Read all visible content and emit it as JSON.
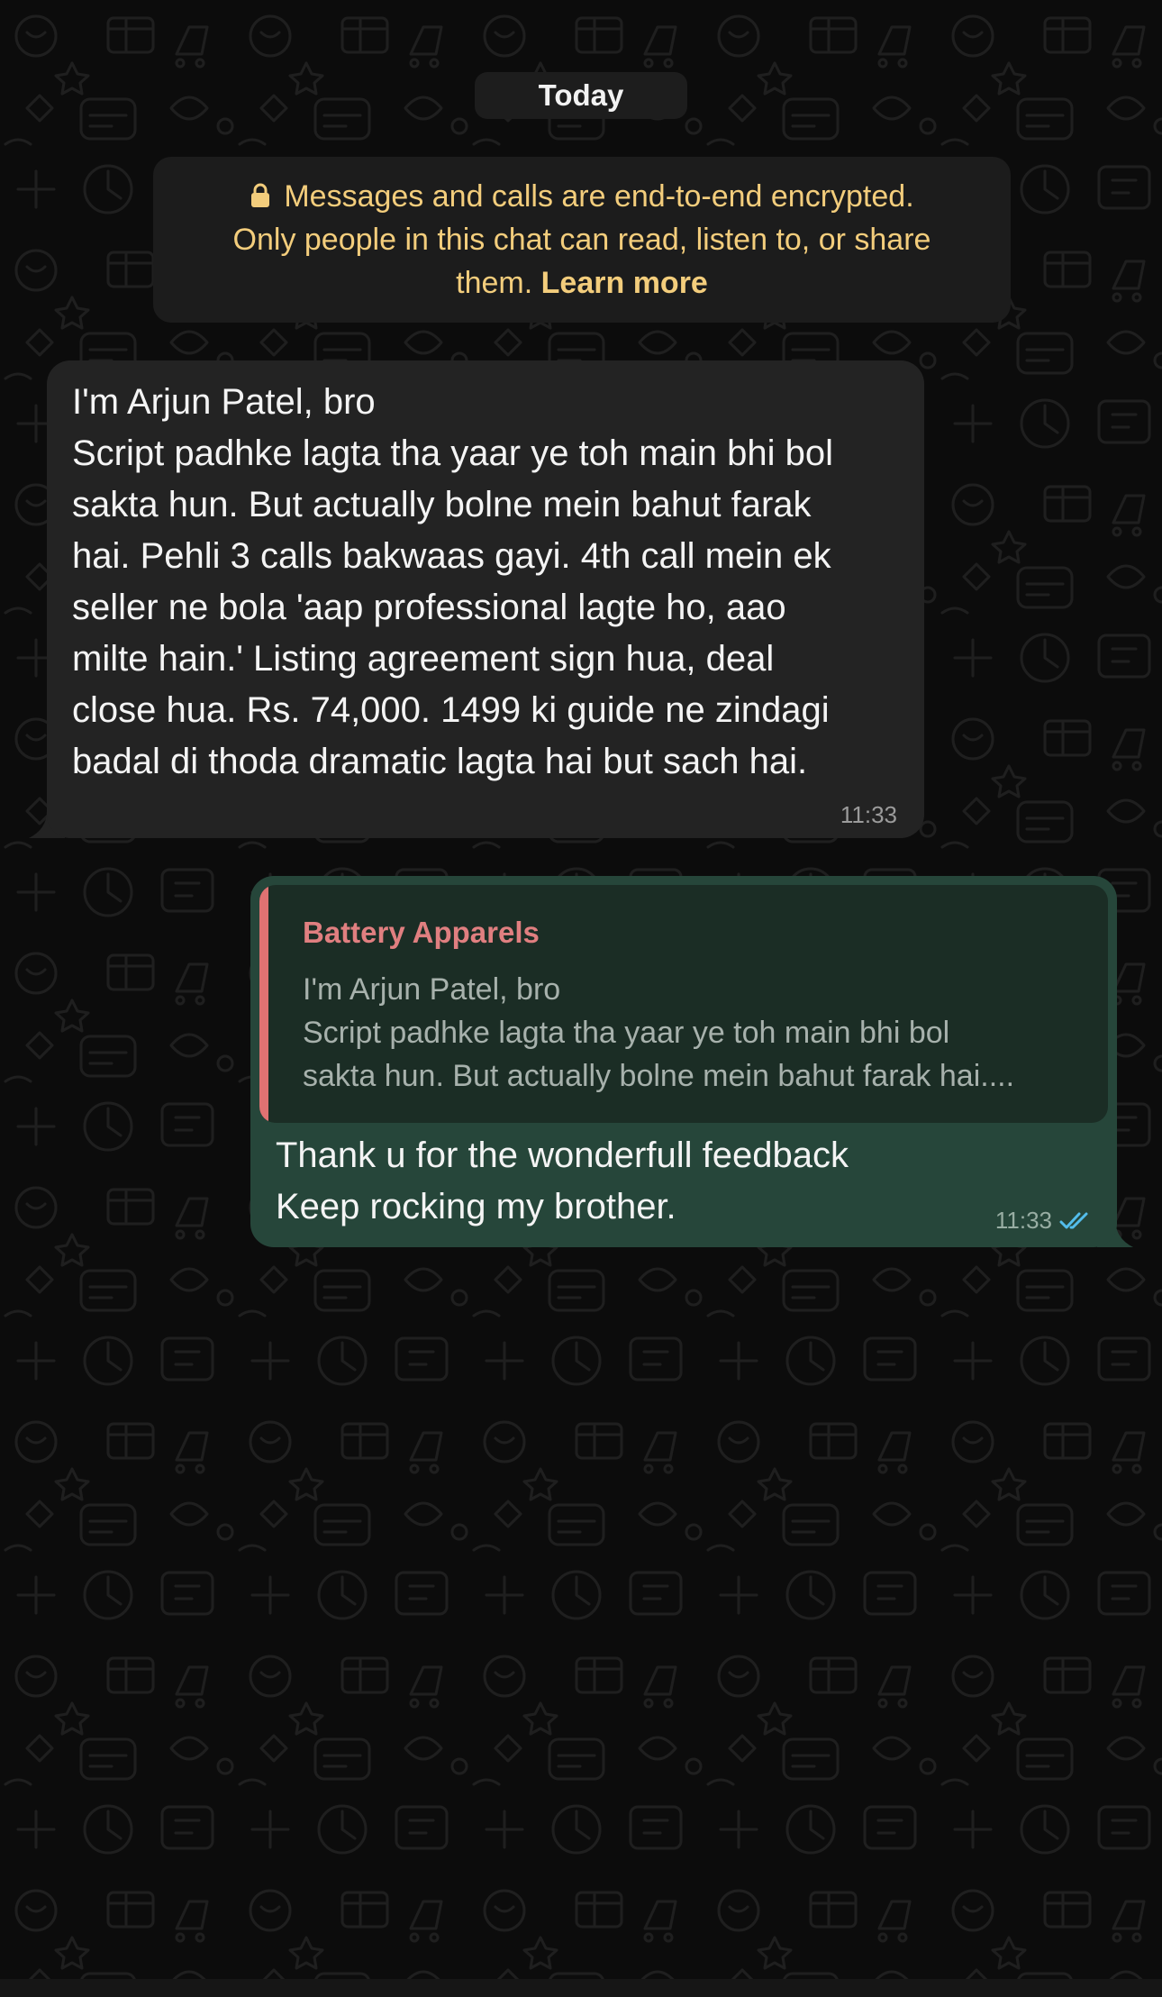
{
  "date_chip": "Today",
  "encryption_notice": {
    "line1": "Messages and calls are end-to-end encrypted.",
    "line2": "Only people in this chat can read, listen to, or share",
    "line3": "them.",
    "learn_more": "Learn more",
    "icon": "lock-icon"
  },
  "messages": [
    {
      "direction": "incoming",
      "lines": [
        "I'm Arjun Patel, bro",
        "Script padhke lagta tha yaar ye toh main bhi bol",
        "sakta hun. But actually bolne mein bahut farak",
        "hai. Pehli 3 calls bakwaas gayi. 4th call mein ek",
        "seller ne bola 'aap professional lagte ho, aao",
        "milte hain.' Listing agreement sign hua, deal",
        "close hua. Rs. 74,000. 1499 ki guide ne zindagi",
        "badal di  thoda dramatic lagta hai but sach hai."
      ],
      "time": "11:33"
    },
    {
      "direction": "outgoing",
      "quote": {
        "author": "Battery Apparels",
        "lines": [
          "I'm Arjun Patel, bro",
          "Script padhke lagta tha yaar ye toh main bhi bol",
          "sakta hun. But actually bolne mein bahut farak hai...."
        ]
      },
      "lines": [
        "Thank u for the wonderfull feedback",
        "Keep rocking my brother."
      ],
      "time": "11:33",
      "status_icon": "double-check-icon"
    }
  ],
  "colors": {
    "background": "#0c0c0c",
    "incoming_bubble": "#232323",
    "outgoing_bubble": "#26463a",
    "quote_accent": "#df7272",
    "notice_text": "#f3cd7c",
    "read_ticks": "#53bdeb"
  }
}
